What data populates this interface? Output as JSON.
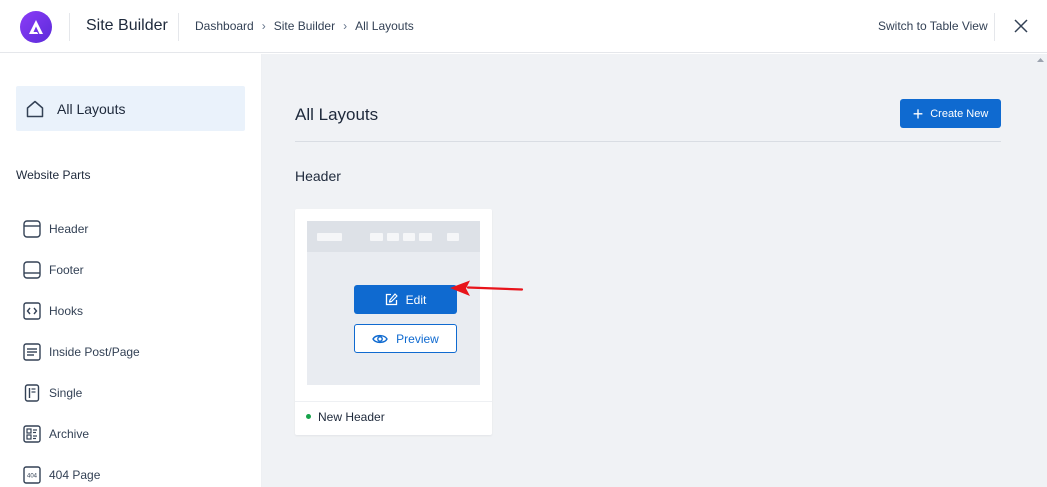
{
  "app": {
    "title": "Site Builder",
    "logo_icon": "astra-logo-icon",
    "brand_color": "#6a33e8"
  },
  "breadcrumb": [
    "Dashboard",
    "Site Builder",
    "All Layouts"
  ],
  "topbar": {
    "switch_view_label": "Switch to Table View",
    "close_icon": "close-icon"
  },
  "sidebar": {
    "active_item": {
      "label": "All Layouts",
      "icon": "home-icon"
    },
    "section_heading": "Website Parts",
    "items": [
      {
        "label": "Header",
        "icon": "header-layout-icon"
      },
      {
        "label": "Footer",
        "icon": "footer-layout-icon"
      },
      {
        "label": "Hooks",
        "icon": "code-icon"
      },
      {
        "label": "Inside Post/Page",
        "icon": "post-content-icon"
      },
      {
        "label": "Single",
        "icon": "single-page-icon"
      },
      {
        "label": "Archive",
        "icon": "archive-icon"
      },
      {
        "label": "404 Page",
        "icon": "404-icon"
      }
    ]
  },
  "main": {
    "title": "All Layouts",
    "create_button_label": "Create New",
    "section_title": "Header",
    "accent_color": "#0f6ad0",
    "card": {
      "edit_label": "Edit",
      "preview_label": "Preview",
      "name": "New Header",
      "status_color": "#16a34a"
    }
  },
  "annotation": {
    "arrow_color": "#e8141b"
  }
}
